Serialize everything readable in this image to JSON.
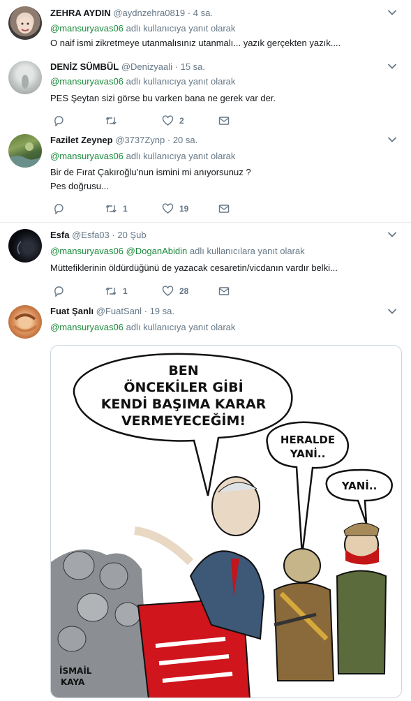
{
  "reply_prefix": "adlı kullanıcıya yanıt olarak",
  "reply_prefix_plural": "adlı kullanıcılara yanıt olarak",
  "tweets": [
    {
      "name": "ZEHRA AYDIN",
      "handle": "@aydnzehra0819",
      "sep": "·",
      "time": "4 sa.",
      "mentions": [
        "@mansuryavas06"
      ],
      "text": [
        "O naif ismi zikretmeye utanmalısınız utanmalı... yazık gerçekten yazık...."
      ]
    },
    {
      "name": "DENİZ SÜMBÜL",
      "handle": "@Denizyaali",
      "sep": "·",
      "time": "15 sa.",
      "mentions": [
        "@mansuryavas06"
      ],
      "text": [
        "PES Şeytan sizi görse bu varken bana ne gerek var der."
      ],
      "retweets": "",
      "likes": "2"
    },
    {
      "name": "Fazilet Zeynep",
      "handle": "@3737Zynp",
      "sep": "·",
      "time": "20 sa.",
      "mentions": [
        "@mansuryavas06"
      ],
      "text": [
        "Bir de Fırat Çakıroğlu’nun ismini mi anıyorsunuz ?",
        "Pes doğrusu..."
      ],
      "retweets": "1",
      "likes": "19"
    },
    {
      "name": "Esfa",
      "handle": "@Esfa03",
      "sep": "·",
      "time": "20 Şub",
      "mentions": [
        "@mansuryavas06",
        "@DoganAbidin"
      ],
      "text": [
        "Müttefiklerinin öldürdüğünü de yazacak cesaretin/vicdanın vardır belki..."
      ],
      "retweets": "1",
      "likes": "28"
    },
    {
      "name": "Fuat Şanlı",
      "handle": "@FuatSanl",
      "sep": "·",
      "time": "19 sa.",
      "mentions": [
        "@mansuryavas06"
      ],
      "text": []
    }
  ],
  "cartoon": {
    "bubble1": [
      "BEN",
      "ÖNCEKİLER GİBİ",
      "KENDİ BAŞIMA KARAR",
      "VERMEYECEĞİM!"
    ],
    "bubble2": [
      "HERALDE",
      "YANİ.."
    ],
    "bubble3": [
      "YANİ.."
    ],
    "signature": [
      "İSMAİL",
      "KAYA"
    ]
  },
  "colors": {
    "mention": "#1b8a3c",
    "secondary": "#657786",
    "podium": "#d0151d",
    "suit": "#3e5878"
  },
  "icons": [
    "reply-icon",
    "retweet-icon",
    "like-icon",
    "message-icon",
    "chevron-down-icon"
  ]
}
